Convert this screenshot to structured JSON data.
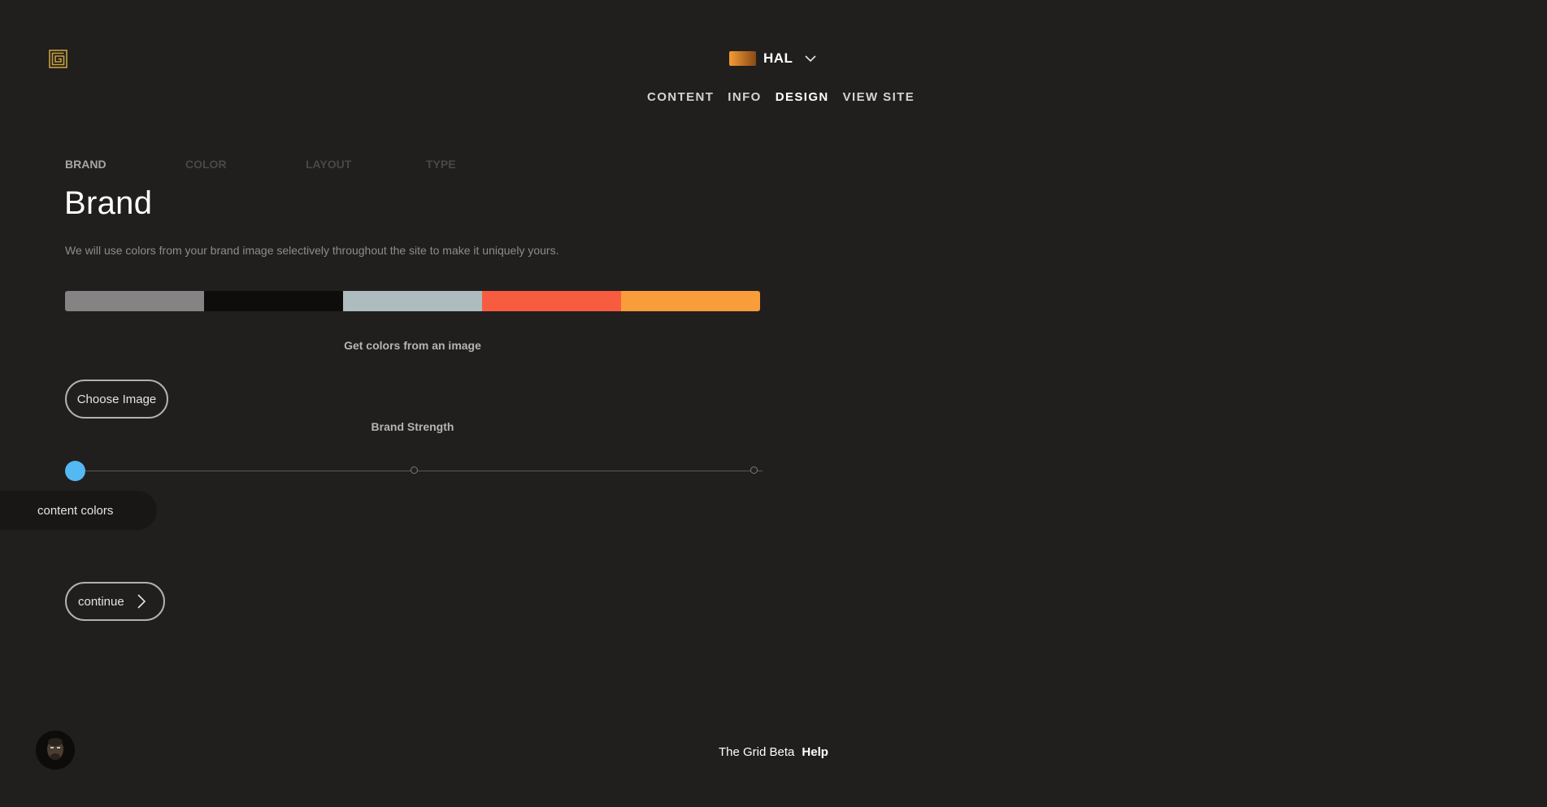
{
  "logo": {
    "icon": "grid-spiral-logo-icon",
    "color": "#c9a23a"
  },
  "site": {
    "name": "HAL",
    "thumb_gradient": [
      "#f59a36",
      "#8a4a16"
    ],
    "chevron_icon": "chevron-down-icon"
  },
  "nav": {
    "content": "CONTENT",
    "info": "INFO",
    "design": "DESIGN",
    "view_site": "VIEW SITE",
    "active": "design"
  },
  "tabs": {
    "brand": "BRAND",
    "color": "COLOR",
    "layout": "LAYOUT",
    "type": "TYPE",
    "active": "brand"
  },
  "page": {
    "title": "Brand",
    "description": "We will use colors from your brand image selectively throughout the site to make it uniquely yours."
  },
  "palette": [
    "#858384",
    "#0e0d0c",
    "#acbcbf",
    "#f85c40",
    "#f99c3a"
  ],
  "image": {
    "get_colors_label": "Get colors from an image",
    "choose_label": "Choose Image"
  },
  "strength": {
    "label": "Brand Strength",
    "stops": 3,
    "selected_index": 0,
    "knob_color": "#54b8f3",
    "tooltip": "content colors"
  },
  "continue": {
    "label": "continue",
    "icon": "chevron-right-icon"
  },
  "footer": {
    "brand": "The Grid Beta",
    "help": "Help"
  },
  "user": {
    "avatar_icon": "user-avatar"
  }
}
